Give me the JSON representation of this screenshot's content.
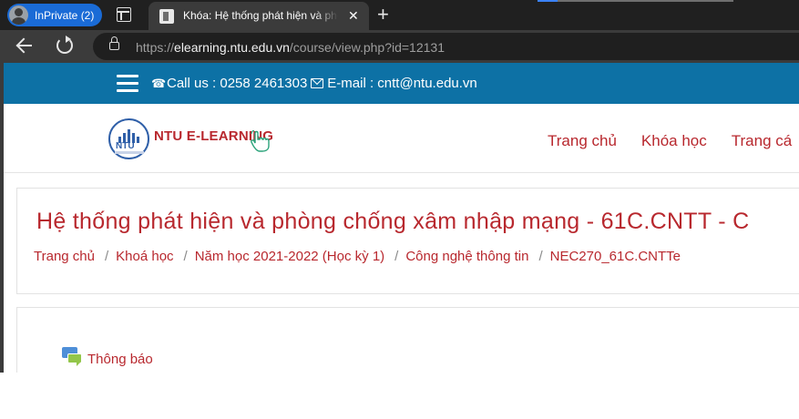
{
  "browser": {
    "profile_label": "InPrivate (2)",
    "tab_title": "Khóa: Hệ thống phát hiện và phòng",
    "tab_close": "✕",
    "new_tab": "+",
    "url_prefix": "https://",
    "url_host": "elearning.ntu.edu.vn",
    "url_path": "/course/view.php?id=12131"
  },
  "topbar": {
    "phone_icon": "☎",
    "phone_text": "Call us : 0258 2461303",
    "email_text": "E-mail : cntt@ntu.edu.vn",
    "colors": {
      "background": "#0d71a5",
      "text": "#ffffff"
    }
  },
  "logo": {
    "seal_text": "NTU",
    "brand_text": "NTU E-LEARNING"
  },
  "menu": {
    "items": [
      "Trang chủ",
      "Khóa học",
      "Trang cá"
    ]
  },
  "course": {
    "title": "Hệ thống phát hiện và phòng chống xâm nhập mạng - 61C.CNTT - C",
    "breadcrumb": [
      "Trang chủ",
      "Khoá học",
      "Năm học 2021-2022 (Học kỳ 1)",
      "Công nghệ thông tin",
      "NEC270_61C.CNTTe"
    ],
    "separator": "/"
  },
  "content": {
    "announcement_label": "Thông báo"
  },
  "colors": {
    "accent_red": "#b8282e",
    "header_blue": "#0d71a5",
    "chrome_dark": "#202020"
  }
}
